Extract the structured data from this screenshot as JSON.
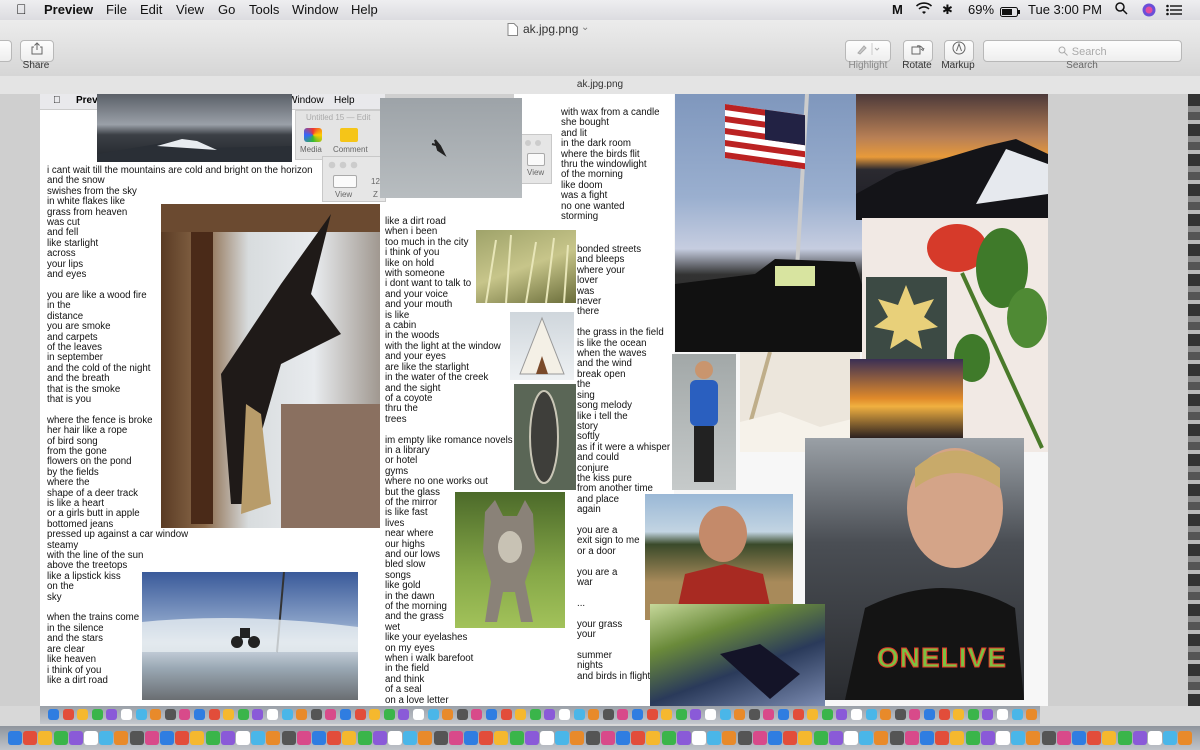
{
  "menubar": {
    "app": "Preview",
    "menus": [
      "File",
      "Edit",
      "View",
      "Go",
      "Tools",
      "Window",
      "Help"
    ],
    "battery": "69%",
    "clock": "Tue 3:00 PM"
  },
  "toolbar": {
    "share_label": "Share",
    "highlight_label": "Highlight",
    "rotate_label": "Rotate",
    "markup_label": "Markup",
    "search_label": "Search",
    "search_placeholder": "Search",
    "window_title": "ak.jpg.png",
    "doc_title": "ak.jpg.png"
  },
  "inner": {
    "app": "Previ",
    "menus": [
      "Window",
      "Help"
    ],
    "untitled": "Untitled 15 — Edit",
    "media": "Media",
    "comment": "Comment",
    "view": "View",
    "view2": "View",
    "zoom_val": "12",
    "zoom_z": "Z"
  },
  "poems": {
    "col1": "i cant wait till the mountains are cold and bright on the horizon\nand the snow\nswishes from the sky\nin white flakes like\ngrass from heaven\nwas cut\nand fell\nlike starlight\nacross\nyour lips\nand eyes\n\nyou are like a wood fire\nin the\ndistance\nyou are smoke\nand carpets\nof the leaves\nin september\nand the cold of the night\nand the breath\nthat is the smoke\nthat is you\n\nwhere the fence is broke\nher hair like a rope\nof bird song\nfrom the gone\nflowers on the pond\nby the fields\nwhere the\nshape of a deer track\nis like a heart\nor a girls butt in apple\nbottomed jeans\npressed up against a car window\nsteamy\nwith the line of the sun\nabove the treetops\nlike a lipstick kiss\non the\nsky\n\nwhen the trains come\nin the silence\nand the stars\nare clear\nlike heaven\ni think of you\nlike a dirt road",
    "col2a": "like a dirt road\nwhen i been\ntoo much in the city\ni think of you\nlike on hold\nwith someone\ni dont want to talk to\nand your voice\nand your mouth\nis like\na cabin\nin the woods\nwith the light at the window\nand your eyes\nare like the starlight\nin the water of the creek\nand the sight\nof a coyote\nthru the\ntrees\n\nim empty like romance novels\nin a library\nor hotel\ngyms\nwhere no one works out\nbut the glass\nof the mirror\nis like fast\nlives\nnear where\nour highs\nand our lows\nbled slow\nsongs\nlike gold\nin the dawn\nof the morning\nand the grass\nwet\nlike your eyelashes\non my eyes\nwhen i walk barefoot\nin the field\nand think\nof a seal\non a love letter",
    "col3a": "with wax from a candle\nshe bought\nand lit\nin the dark room\nwhere the birds flit\nthru the windowlight\nof the morning\nlike doom\nwas a fight\nno one wanted\nstorming",
    "col3b": "bonded streets\nand bleeps\nwhere your\nlover\nwas\nnever\nthere\n\nthe grass in the field\nis like the ocean\nwhen the waves\nand the wind\nbreak open\nthe\nsing\nsong melody\nlike i tell the\nstory\nsoftly\nas if it were a whisper\nand could\nconjure\nthe kiss pure\nfrom another time\nand place\nagain\n\nyou are a\nexit sign to me\nor a door\n\nyou are a\nwar\n\n...\n\nyour grass\nyour\n\nsummer\nnights\nand birds in flight",
    "shirt": "ONELIVE"
  },
  "colors": {
    "menubar": "#e6e6e8",
    "toolbar": "#e0e0e0",
    "sky_blue": "#7f97bd",
    "sunset": "#e89a3a"
  },
  "icons": [
    "apple-icon",
    "share-icon",
    "highlight-icon",
    "rotate-icon",
    "markup-icon",
    "search-icon",
    "wifi-icon",
    "battery-icon",
    "spotlight-icon",
    "siri-icon",
    "list-icon",
    "document-icon",
    "m-icon"
  ]
}
